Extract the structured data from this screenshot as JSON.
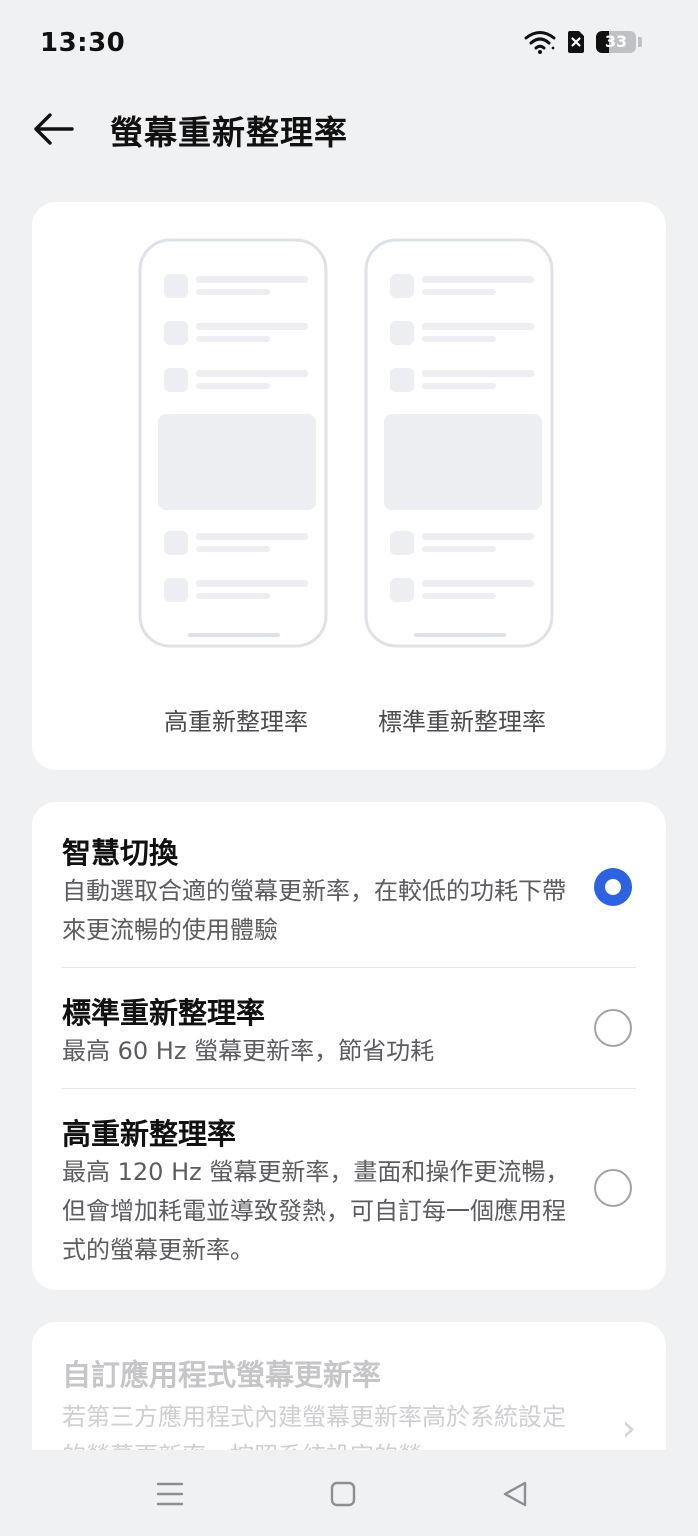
{
  "status_bar": {
    "time": "13:30",
    "battery_level": "33",
    "icons": [
      "wifi-icon",
      "no-sim-icon",
      "battery-icon"
    ]
  },
  "header": {
    "title": "螢幕重新整理率",
    "back_icon": "arrow-left-icon"
  },
  "preview": {
    "labels": [
      "高重新整理率",
      "標準重新整理率"
    ]
  },
  "options": [
    {
      "title": "智慧切換",
      "description": "自動選取合適的螢幕更新率，在較低的功耗下帶來更流暢的使用體驗",
      "selected": true
    },
    {
      "title": "標準重新整理率",
      "description": "最高 60 Hz 螢幕更新率，節省功耗",
      "selected": false
    },
    {
      "title": "高重新整理率",
      "description": "最高 120 Hz 螢幕更新率，畫面和操作更流暢，但會增加耗電並導致發熱，可自訂每一個應用程式的螢幕更新率。",
      "selected": false
    }
  ],
  "custom_app": {
    "title": "自訂應用程式螢幕更新率",
    "description": "若第三方應用程式內建螢幕更新率高於系統設定的螢幕更新率，按照系統設定的螢",
    "chevron_icon": "chevron-right-icon",
    "enabled": false
  },
  "nav_bar": {
    "icons": [
      "menu-icon",
      "home-icon",
      "back-triangle-icon"
    ]
  },
  "colors": {
    "accent": "#2d63e0",
    "background": "#f0f1f3",
    "card": "#ffffff"
  }
}
